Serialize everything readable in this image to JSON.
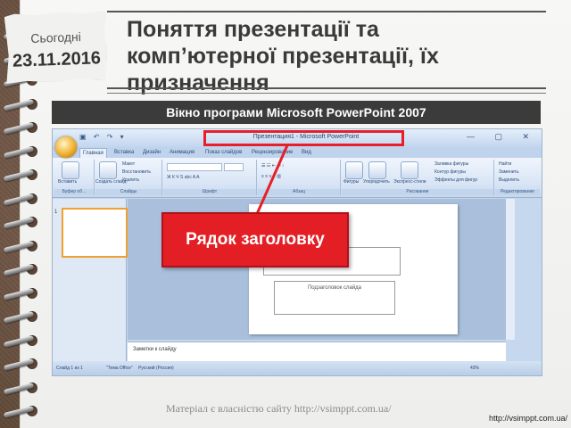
{
  "date": {
    "label": "Сьогодні",
    "value": "23.11.2016"
  },
  "title": {
    "text": "Поняття презентації та комп’ютерної презентації, їх призначення"
  },
  "screenshot": {
    "caption": "Вікно програми Microsoft PowerPoint 2007",
    "window_title": "Презентация1 - Microsoft PowerPoint",
    "tabs": [
      "Главная",
      "Вставка",
      "Дизайн",
      "Анимация",
      "Показ слайдов",
      "Рецензирование",
      "Вид"
    ],
    "ribbon": {
      "paste": "Вставить",
      "create_slide": "Создать слайд",
      "layout": "Макет",
      "reset": "Восстановить",
      "delete": "Удалить",
      "figures": "Фигуры",
      "arrange": "Упорядочить",
      "express_styles": "Экспресс-стили",
      "fill": "Заливка фигуры",
      "outline": "Контур фигуры",
      "effects": "Эффекты для фигур",
      "find": "Найти",
      "replace": "Заменить",
      "select": "Выделить",
      "groups": [
        "Буфер об...",
        "Слайды",
        "Шрифт",
        "Абзац",
        "Рисование",
        "Редактирование"
      ]
    },
    "slide": {
      "title_placeholder": "слайда",
      "subtitle_placeholder": "Подзаголовок слайда"
    },
    "thumb_number": "1",
    "notes_placeholder": "Заметки к слайду",
    "status": {
      "slide": "Слайд 1 из 1",
      "theme": "\"Тема Office\"",
      "language": "Русский (Россия)",
      "zoom": "43%"
    },
    "callout_label": "Рядок заголовку"
  },
  "footer": {
    "copyright": "Матеріал є власністю сайту http://vsimppt.com.ua/",
    "url": "http://vsimppt.com.ua/"
  }
}
